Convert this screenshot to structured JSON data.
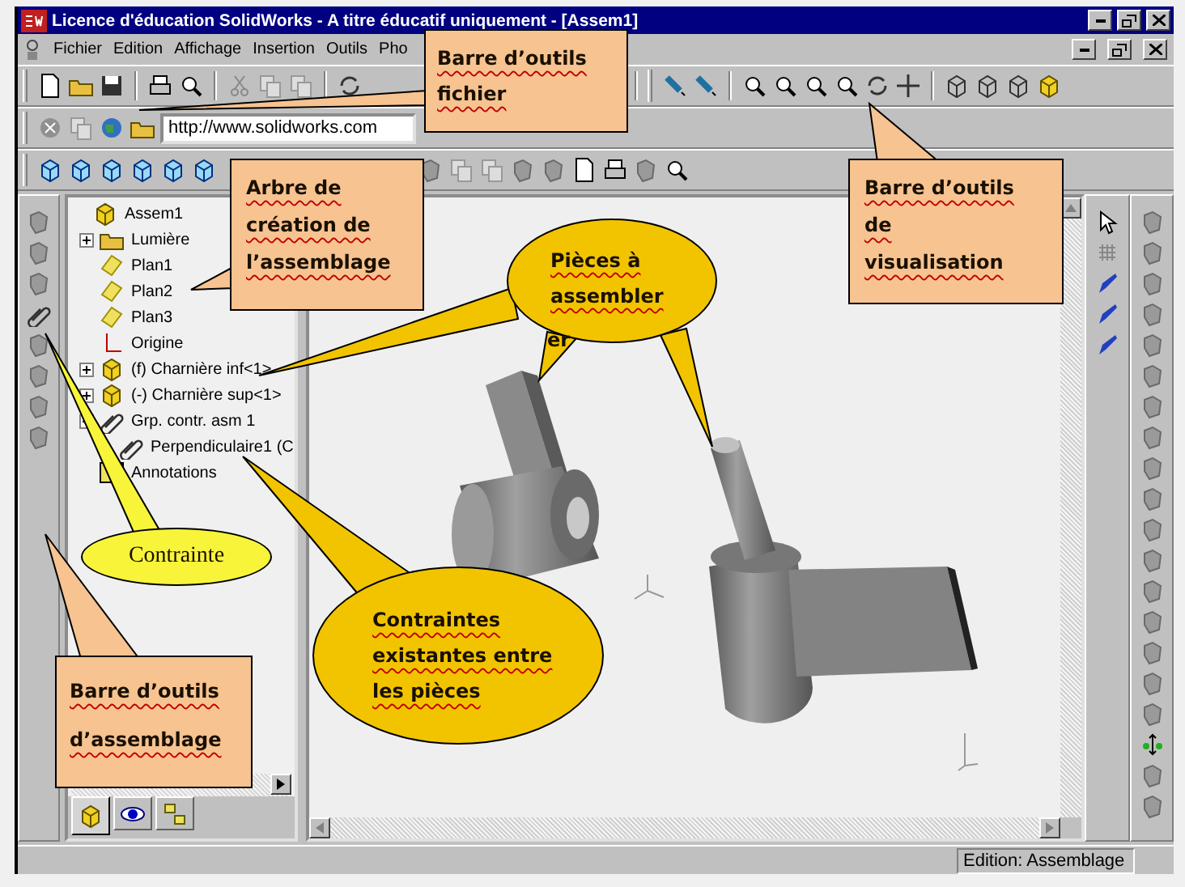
{
  "window": {
    "title": "Licence d'éducation SolidWorks - A titre éducatif uniquement - [Assem1]"
  },
  "menu": [
    "Fichier",
    "Edition",
    "Affichage",
    "Insertion",
    "Outils",
    "Pho"
  ],
  "address_bar": {
    "value": "http://www.solidworks.com"
  },
  "feature_tree": {
    "items": [
      {
        "label": "Assem1",
        "kind": "assembly",
        "children": [
          {
            "label": "Lumière",
            "kind": "light",
            "expanded": false
          },
          {
            "label": "Plan1",
            "kind": "plane"
          },
          {
            "label": "Plan2",
            "kind": "plane"
          },
          {
            "label": "Plan3",
            "kind": "plane"
          },
          {
            "label": "Origine",
            "kind": "origin"
          },
          {
            "label": "(f) Charnière inf<1>",
            "kind": "part",
            "expanded": false
          },
          {
            "label": "(-) Charnière sup<1>",
            "kind": "part",
            "expanded": false
          },
          {
            "label": "Grp. contr. asm 1",
            "kind": "mates",
            "expanded": true,
            "children": [
              {
                "label": "Perpendiculaire1 (C",
                "kind": "mate"
              }
            ]
          },
          {
            "label": "Annotations",
            "kind": "annotations"
          }
        ]
      }
    ]
  },
  "tree_tabs": [
    {
      "kind": "features",
      "selected": true
    },
    {
      "kind": "display",
      "selected": false
    },
    {
      "kind": "configurations",
      "selected": false
    }
  ],
  "status_bar": {
    "mode": "Edition: Assemblage"
  },
  "callouts": [
    {
      "kind": "box",
      "color": "#f6c391",
      "text": "Barre d’outils\nfichier"
    },
    {
      "kind": "box",
      "color": "#f6c391",
      "text": "Arbre de\ncréation de\nl’assemblage"
    },
    {
      "kind": "box",
      "color": "#f6c391",
      "text": "Barre d’outils\nde\nvisualisation"
    },
    {
      "kind": "ellipse",
      "color": "#f2c400",
      "text": "Pièces à\nassembler"
    },
    {
      "kind": "plain-ellipse",
      "color": "#f8f43a",
      "text": "Contrainte"
    },
    {
      "kind": "ellipse",
      "color": "#f2c400",
      "text": "Contraintes\nexistantes entre\nles pièces"
    },
    {
      "kind": "box",
      "color": "#f6c391",
      "text": "Barre d’outils\nd’assemblage"
    }
  ],
  "stray_text": "er"
}
